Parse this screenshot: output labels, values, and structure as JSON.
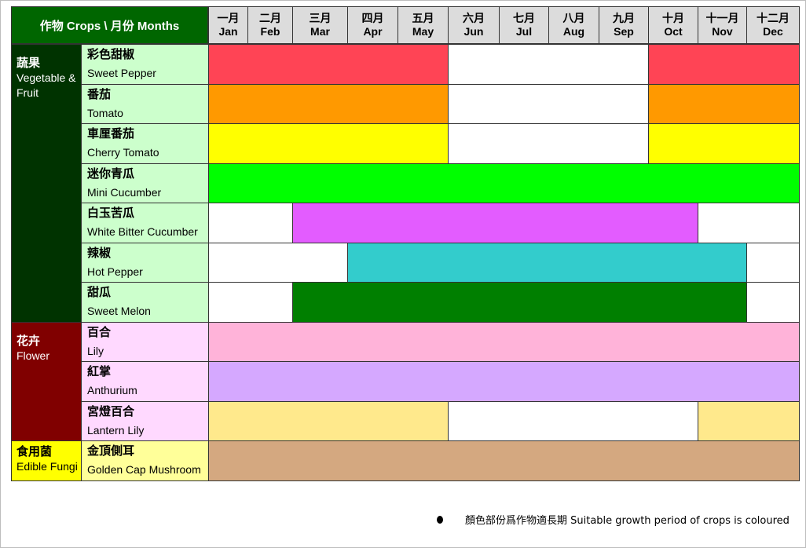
{
  "chart_data": {
    "type": "table",
    "title": "作物 Crops \\ 月份 Months",
    "months": [
      {
        "zh": "一月",
        "en": "Jan"
      },
      {
        "zh": "二月",
        "en": "Feb"
      },
      {
        "zh": "三月",
        "en": "Mar"
      },
      {
        "zh": "四月",
        "en": "Apr"
      },
      {
        "zh": "五月",
        "en": "May"
      },
      {
        "zh": "六月",
        "en": "Jun"
      },
      {
        "zh": "七月",
        "en": "Jul"
      },
      {
        "zh": "八月",
        "en": "Aug"
      },
      {
        "zh": "九月",
        "en": "Sep"
      },
      {
        "zh": "十月",
        "en": "Oct"
      },
      {
        "zh": "十一月",
        "en": "Nov"
      },
      {
        "zh": "十二月",
        "en": "Dec"
      }
    ],
    "categories": [
      {
        "zh": "蔬果",
        "en": "Vegetable & Fruit",
        "color": "#003300",
        "text_color": "#ffffff",
        "row_bg": "#ccffcc",
        "rows": [
          0,
          1,
          2,
          3,
          4,
          5,
          6
        ]
      },
      {
        "zh": "花卉",
        "en": "Flower",
        "color": "#800000",
        "text_color": "#ffffff",
        "row_bg": "#ffd9ff",
        "rows": [
          7,
          8,
          9
        ]
      },
      {
        "zh": "食用菌",
        "en": "Edible Fungi",
        "color": "#ffff00",
        "text_color": "#000000",
        "row_bg": "#ffff99",
        "rows": [
          10
        ]
      }
    ],
    "crops": [
      {
        "zh": "彩色甜椒",
        "en": "Sweet Pepper",
        "color": "#ff4455",
        "months": [
          1,
          2,
          3,
          4,
          5,
          10,
          11,
          12
        ]
      },
      {
        "zh": "番茄",
        "en": "Tomato",
        "color": "#ff9900",
        "months": [
          1,
          2,
          3,
          4,
          5,
          10,
          11,
          12
        ]
      },
      {
        "zh": "車厘番茄",
        "en": "Cherry Tomato",
        "color": "#ffff00",
        "months": [
          1,
          2,
          3,
          4,
          5,
          10,
          11,
          12
        ]
      },
      {
        "zh": "迷你青瓜",
        "en": "Mini Cucumber",
        "color": "#00ff00",
        "months": [
          1,
          2,
          3,
          4,
          5,
          6,
          7,
          8,
          9,
          10,
          11,
          12
        ]
      },
      {
        "zh": "白玉苦瓜",
        "en": "White Bitter Cucumber",
        "color": "#e35cff",
        "months": [
          3,
          4,
          5,
          6,
          7,
          8,
          9,
          10
        ]
      },
      {
        "zh": "辣椒",
        "en": "Hot Pepper",
        "color": "#33cccc",
        "months": [
          4,
          5,
          6,
          7,
          8,
          9,
          10,
          11
        ]
      },
      {
        "zh": "甜瓜",
        "en": "Sweet Melon",
        "color": "#007f00",
        "months": [
          3,
          4,
          5,
          6,
          7,
          8,
          9,
          10,
          11
        ]
      },
      {
        "zh": "百合",
        "en": "Lily",
        "color": "#ffb3d9",
        "months": [
          1,
          2,
          3,
          4,
          5,
          6,
          7,
          8,
          9,
          10,
          11,
          12
        ]
      },
      {
        "zh": "紅掌",
        "en": "Anthurium",
        "color": "#d5a8ff",
        "months": [
          1,
          2,
          3,
          4,
          5,
          6,
          7,
          8,
          9,
          10,
          11,
          12
        ]
      },
      {
        "zh": "宮燈百合",
        "en": "Lantern Lily",
        "color": "#ffe98c",
        "months": [
          1,
          2,
          3,
          4,
          5,
          11,
          12
        ]
      },
      {
        "zh": "金頂側耳",
        "en": "Golden Cap Mushroom",
        "color": "#d4a880",
        "months": [
          1,
          2,
          3,
          4,
          5,
          6,
          7,
          8,
          9,
          10,
          11,
          12
        ]
      }
    ],
    "footnote_bullet": "●",
    "footnote": "顏色部份爲作物適長期 Suitable growth period of crops is coloured"
  }
}
